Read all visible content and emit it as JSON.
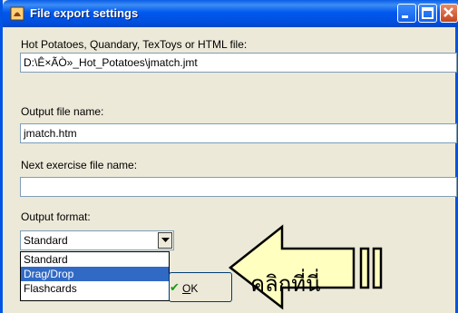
{
  "window": {
    "title": "File export settings",
    "accent_color": "#0054e3",
    "body_color": "#ece9d8"
  },
  "titlebar_buttons": [
    "minimize-icon",
    "maximize-icon",
    "close-icon"
  ],
  "source": {
    "label": "Hot Potatoes, Quandary, TexToys or HTML file:",
    "value": "D:\\Ê×ÃÒ»_Hot_Potatoes\\jmatch.jmt"
  },
  "output": {
    "label": "Output file name:",
    "value": "jmatch.htm"
  },
  "next_exercise": {
    "label": "Next exercise file name:",
    "value": ""
  },
  "format": {
    "label": "Output format:",
    "selected": "Standard",
    "options": [
      "Standard",
      "Drag/Drop",
      "Flashcards"
    ],
    "highlighted_option": "Drag/Drop",
    "highlight_color": "#316ac5"
  },
  "ok_button": {
    "label_underlined": "O",
    "label_rest": "K",
    "icon": "checkmark-icon"
  },
  "callout": {
    "text": "คลิกที่นี่",
    "fill_color": "#ffffc0",
    "icon": "left-arrow-icon"
  }
}
